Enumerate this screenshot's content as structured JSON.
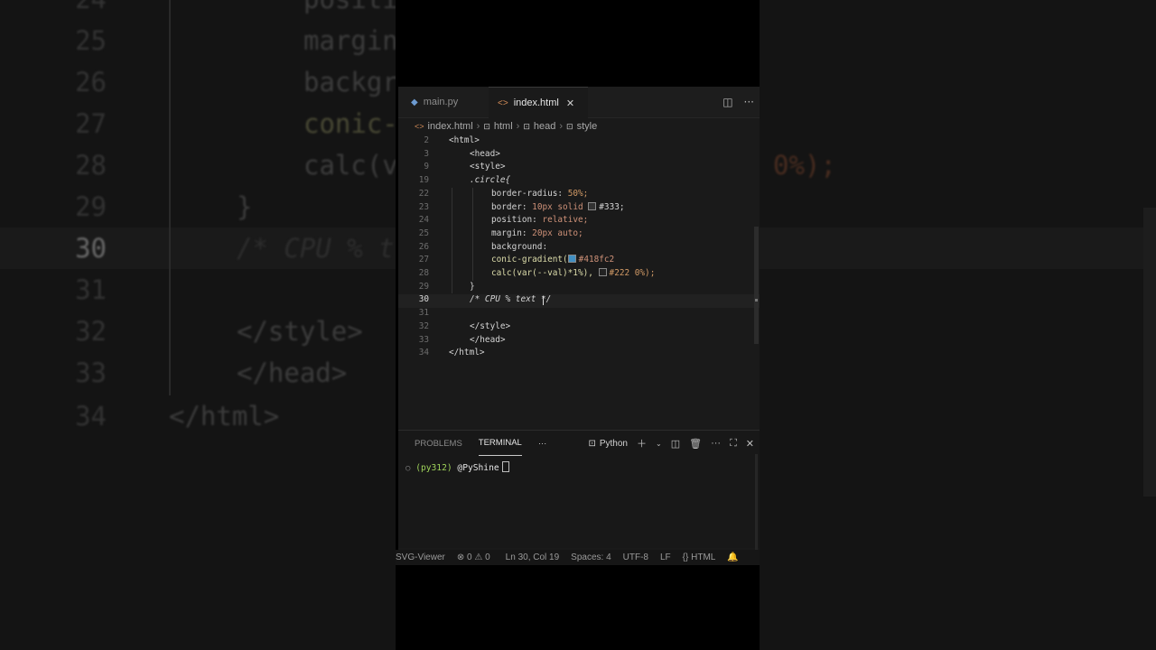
{
  "background": {
    "line_numbers": [
      "24",
      "25",
      "26",
      "27",
      "28",
      "29",
      "30",
      "31",
      "32",
      "33",
      "34"
    ],
    "lines": [
      "positi",
      "margin",
      "backgr",
      "conic-",
      "calc(v",
      "}",
      "/* CPU % t",
      "",
      "</style>",
      "</head>",
      "</html>"
    ],
    "tail_text": "0%);"
  },
  "tabs": [
    {
      "label": "main.py",
      "icon": "python-icon"
    },
    {
      "label": "index.html",
      "icon": "html-icon"
    }
  ],
  "breadcrumbs": [
    "index.html",
    "html",
    "head",
    "style"
  ],
  "code_lines": [
    {
      "n": "2",
      "text": "<html>"
    },
    {
      "n": "3",
      "text": "<head>"
    },
    {
      "n": "9",
      "text": "<style>"
    },
    {
      "n": "19",
      "text": ".circle{"
    },
    {
      "n": "22",
      "prop": "border-radius:",
      "val": "50%;"
    },
    {
      "n": "23",
      "prop": "border:",
      "val": "10px solid",
      "swatch": "#333333",
      "val2": "#333;"
    },
    {
      "n": "24",
      "prop": "position:",
      "val": "relative;"
    },
    {
      "n": "25",
      "prop": "margin:",
      "val": "20px auto;"
    },
    {
      "n": "26",
      "prop": "background:"
    },
    {
      "n": "27",
      "fn": "conic-gradient(",
      "swatch": "#418fc2",
      "val": "#418fc2"
    },
    {
      "n": "28",
      "fn": "calc(var(--val)*1%),",
      "swatch": "#222222",
      "val": "#222 0%);"
    },
    {
      "n": "29",
      "text": "}"
    },
    {
      "n": "30",
      "text": "/* CPU % text */"
    },
    {
      "n": "31",
      "text": ""
    },
    {
      "n": "32",
      "text": "</style>"
    },
    {
      "n": "33",
      "text": "</head>"
    },
    {
      "n": "34",
      "text": "</html>"
    }
  ],
  "panel": {
    "tabs": [
      "PROBLEMS",
      "TERMINAL"
    ],
    "active_tab": "TERMINAL",
    "more": "···",
    "shell": "Python",
    "prompt_env": "(py312)",
    "prompt_user": "@PyShine"
  },
  "status": {
    "extension": "SVG-Viewer",
    "errors": "0",
    "warnings": "0",
    "position": "Ln 30, Col 19",
    "spaces": "Spaces: 4",
    "encoding": "UTF-8",
    "eol": "LF",
    "language": "HTML"
  },
  "colors": {
    "editor_bg": "#1a1a1a",
    "swatch_blue": "#418fc2",
    "prompt_green": "#9fd35a"
  }
}
